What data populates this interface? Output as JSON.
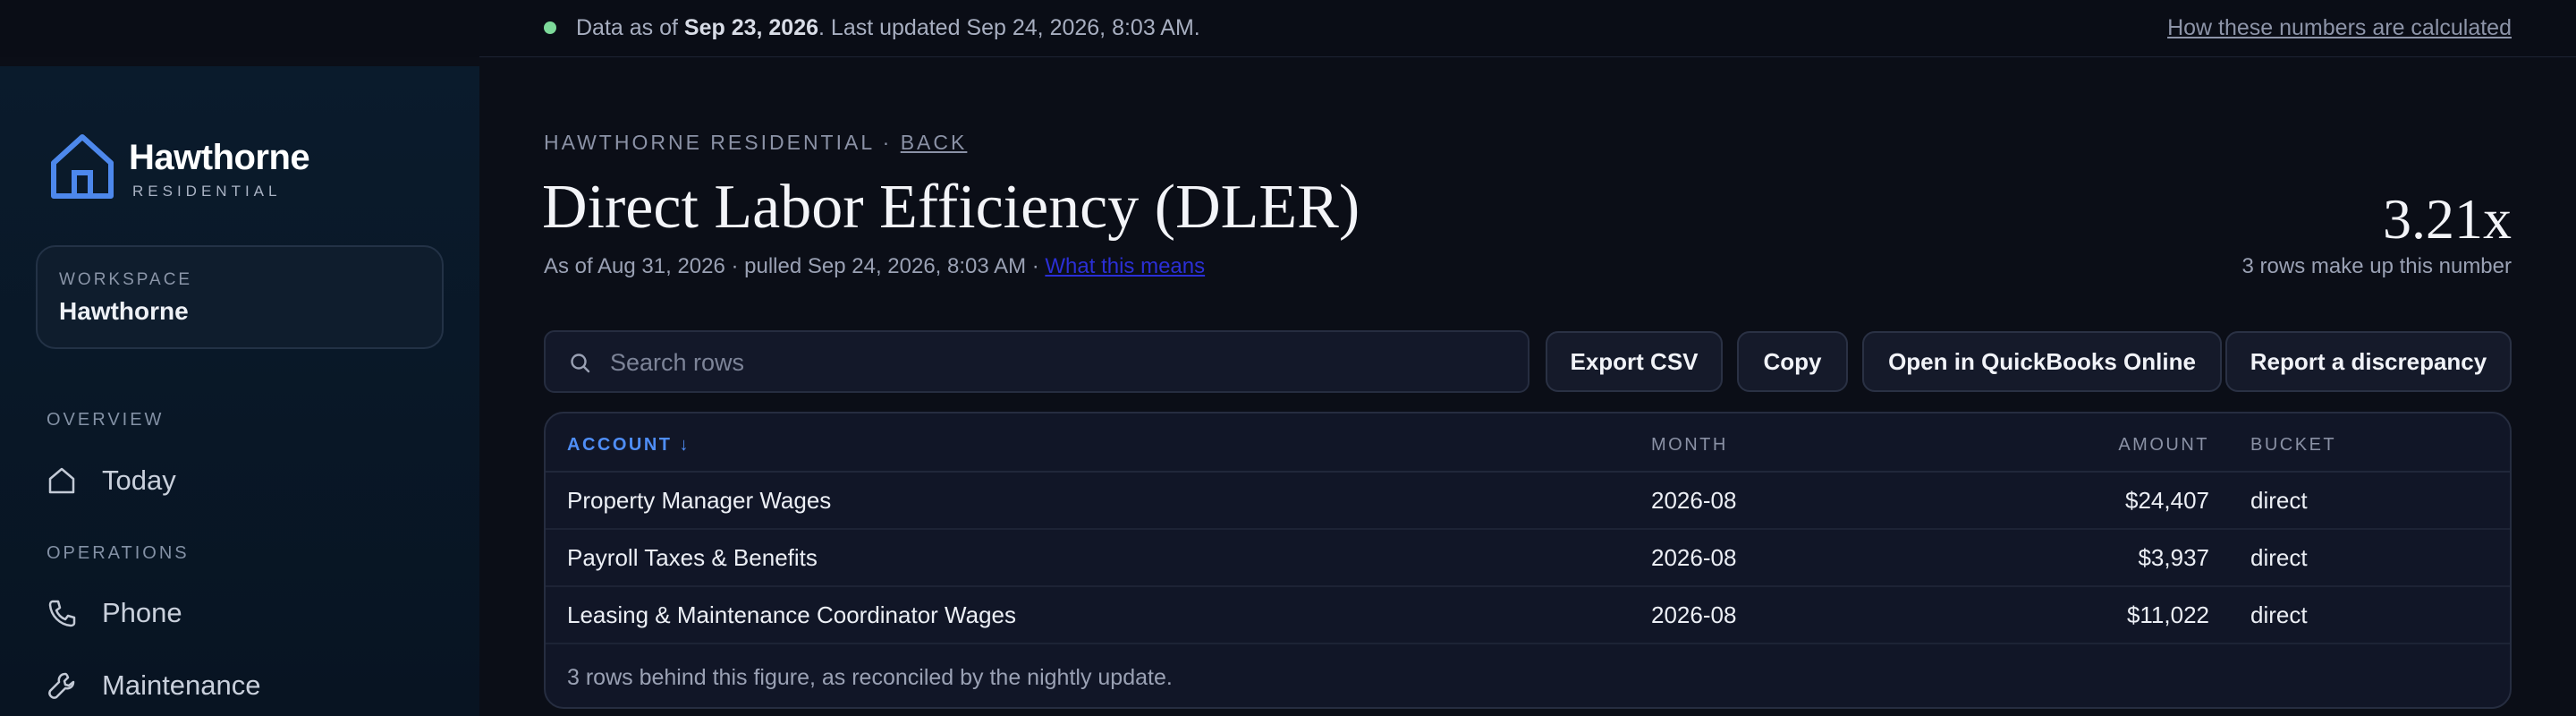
{
  "status": {
    "prefix": "Data as of",
    "date": "Sep 23, 2026",
    "suffix": ". Last updated Sep 24, 2026, 8:03 AM.",
    "dot_color": "#7dd99a",
    "calc_link": "How these numbers are calculated"
  },
  "sidebar": {
    "brand_name": "Hawthorne",
    "brand_sub": "RESIDENTIAL",
    "brand_icon": "house-icon",
    "workspace_label": "WORKSPACE",
    "workspace_value": "Hawthorne",
    "sections": [
      {
        "label": "OVERVIEW",
        "items": [
          {
            "label": "Today",
            "icon": "home-icon"
          }
        ]
      },
      {
        "label": "OPERATIONS",
        "items": [
          {
            "label": "Phone",
            "icon": "phone-icon"
          },
          {
            "label": "Maintenance",
            "icon": "wrench-icon"
          }
        ]
      }
    ]
  },
  "header": {
    "crumb": "HAWTHORNE RESIDENTIAL · ",
    "back": "BACK",
    "title": "Direct Labor Efficiency (DLER)",
    "subtitle": "As of Aug 31, 2026 · pulled Sep 24, 2026, 8:03 AM · ",
    "what_link": "What this means",
    "metric": "3.21x",
    "metric_sub": "3 rows make up this number"
  },
  "toolbar": {
    "search_placeholder": "Search rows",
    "export": "Export CSV",
    "copy": "Copy",
    "open_qbo": "Open in QuickBooks Online",
    "report": "Report a discrepancy"
  },
  "table": {
    "columns": {
      "account": "ACCOUNT ↓",
      "month": "MONTH",
      "amount": "AMOUNT",
      "bucket": "BUCKET"
    },
    "rows": [
      {
        "account": "Property Manager Wages",
        "month": "2026-08",
        "amount": "$24,407",
        "bucket": "direct"
      },
      {
        "account": "Payroll Taxes & Benefits",
        "month": "2026-08",
        "amount": "$3,937",
        "bucket": "direct"
      },
      {
        "account": "Leasing & Maintenance Coordinator Wages",
        "month": "2026-08",
        "amount": "$11,022",
        "bucket": "direct"
      }
    ],
    "footer": "3 rows behind this figure, as reconciled by the nightly update."
  },
  "colors": {
    "accent": "#4f8ef7",
    "link": "#2b2fd6",
    "background": "#0b0e17"
  }
}
